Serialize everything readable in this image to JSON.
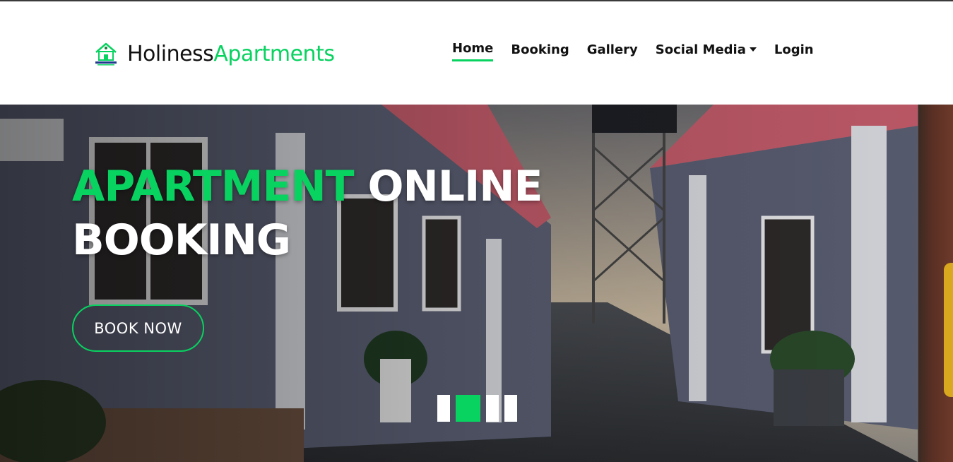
{
  "brand": {
    "name_part1": "Holiness",
    "name_part2": "Apartments",
    "logo_icon": "house-logo-icon",
    "accent_color": "#08d260"
  },
  "nav": {
    "items": [
      {
        "label": "Home",
        "active": true
      },
      {
        "label": "Booking"
      },
      {
        "label": "Gallery"
      },
      {
        "label": "Social Media",
        "has_dropdown": true
      },
      {
        "label": "Login"
      }
    ]
  },
  "hero": {
    "title_accent": "APARTMENT",
    "title_rest_line1": "ONLINE",
    "title_line2": "BOOKING",
    "cta_label": "BOOK NOW",
    "indicator_count": 4,
    "active_indicator": 2
  }
}
